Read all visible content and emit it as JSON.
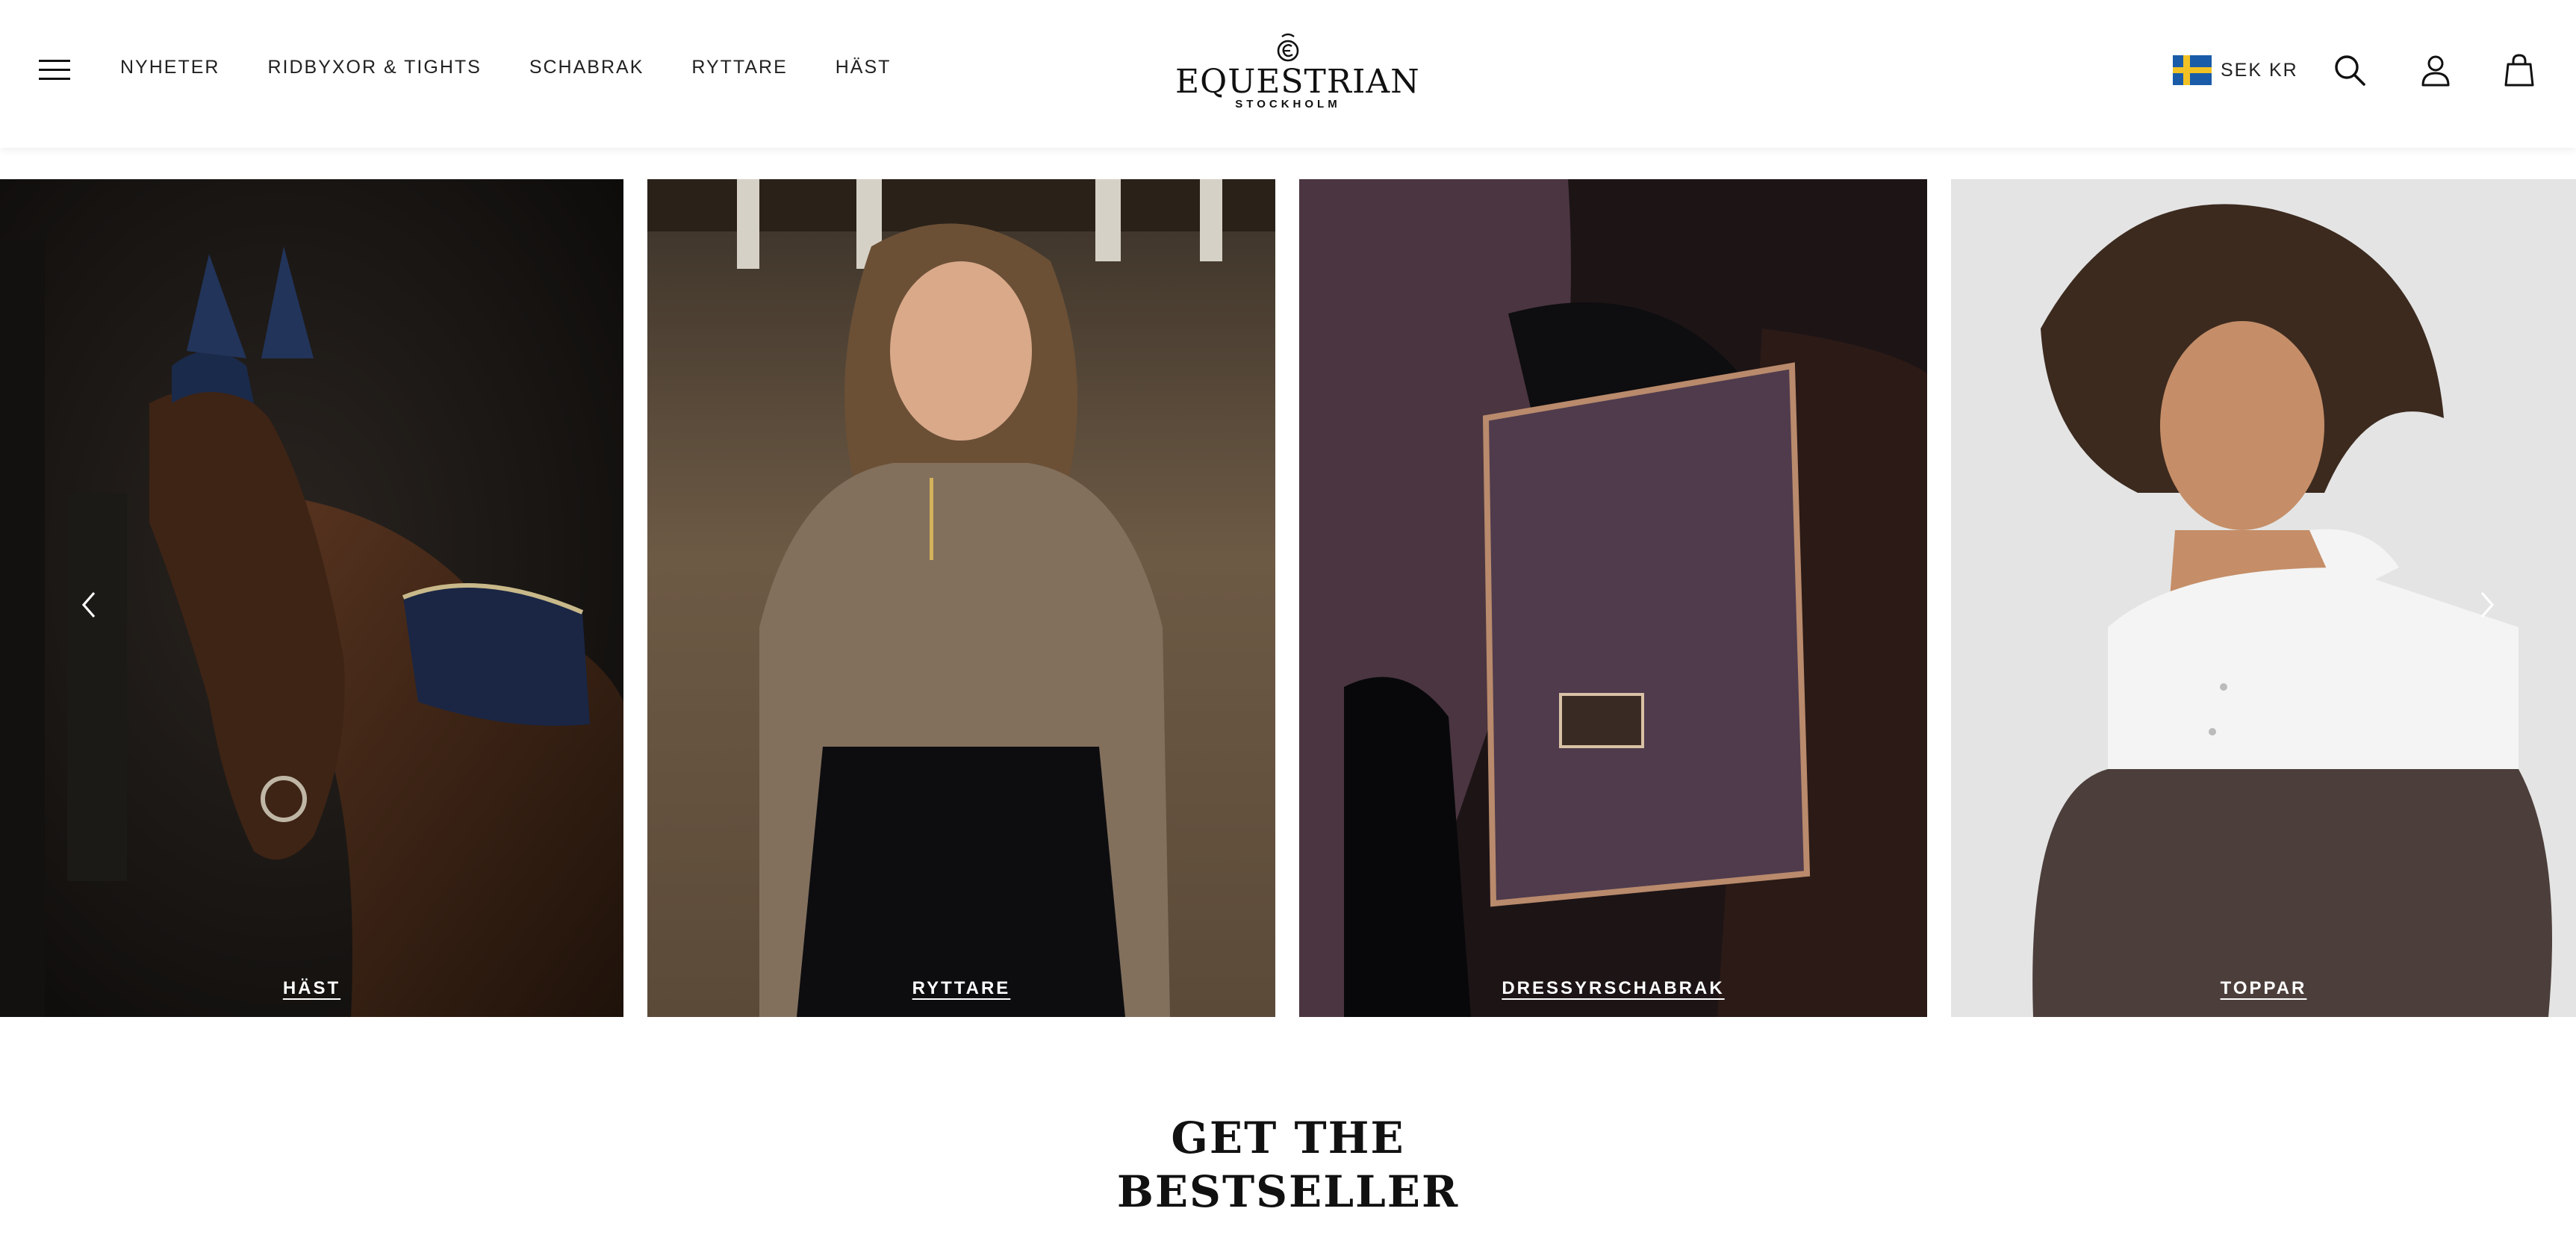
{
  "header": {
    "nav": [
      {
        "label": "NYHETER"
      },
      {
        "label": "RIDBYXOR & TIGHTS"
      },
      {
        "label": "SCHABRAK"
      },
      {
        "label": "RYTTARE"
      },
      {
        "label": "HÄST"
      }
    ],
    "logo": {
      "word": "EQUESTRIAN",
      "sub": "STOCKHOLM"
    },
    "currency": {
      "label": "SEK KR",
      "flag": "sweden-flag-icon"
    },
    "icons": [
      "search-icon",
      "account-icon",
      "bag-icon"
    ]
  },
  "carousel": {
    "tiles": [
      {
        "label": "HÄST"
      },
      {
        "label": "RYTTARE"
      },
      {
        "label": "DRESSYRSCHABRAK"
      },
      {
        "label": "TOPPAR"
      }
    ],
    "prev_icon": "chevron-left-icon",
    "next_icon": "chevron-right-icon"
  },
  "section": {
    "title_line1": "GET THE",
    "title_line2": "BESTSELLER"
  },
  "colors": {
    "flag_blue": "#1a5ca8",
    "flag_yellow": "#f2c224",
    "text": "#111111",
    "background": "#ffffff"
  }
}
